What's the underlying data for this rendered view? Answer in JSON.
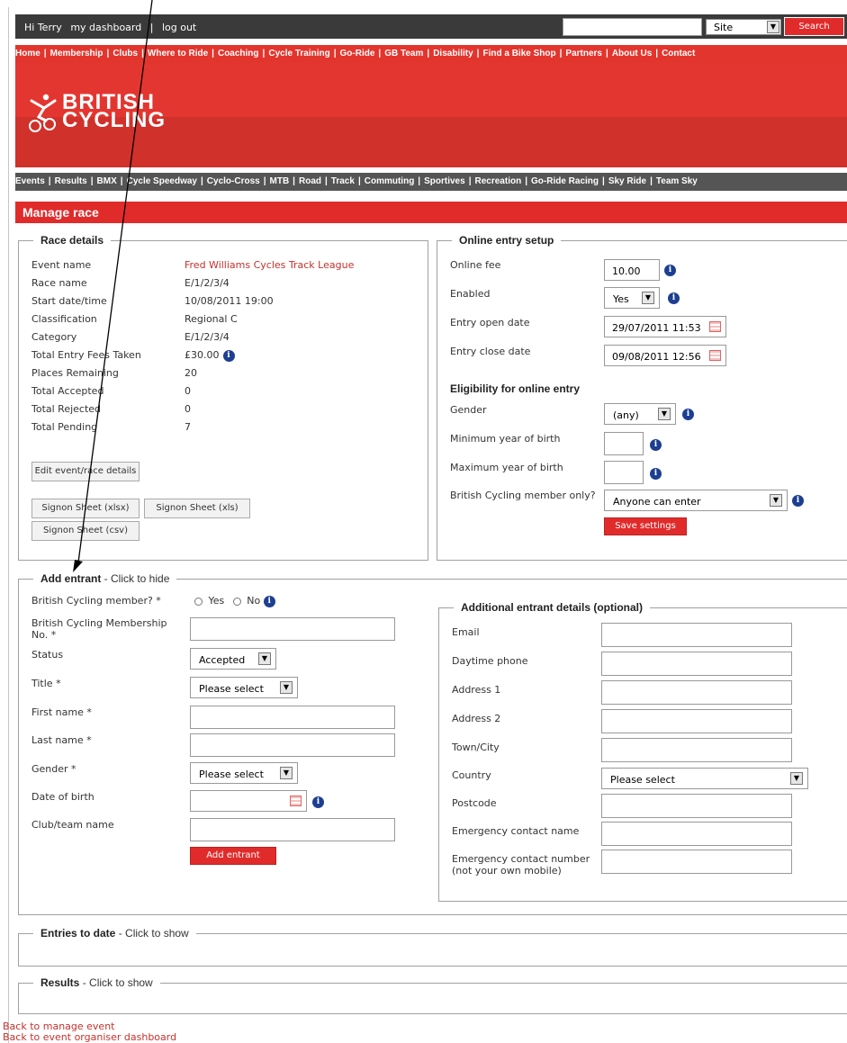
{
  "topbar": {
    "greeting": "Hi Terry",
    "dashboard": "my dashboard",
    "separator": "|",
    "logout": "log out",
    "site_select": "Site",
    "search_button": "Search"
  },
  "main_nav": [
    "Home",
    "Membership",
    "Clubs",
    "Where to Ride",
    "Coaching",
    "Cycle Training",
    "Go-Ride",
    "GB Team",
    "Disability",
    "Find a Bike Shop",
    "Partners",
    "About Us",
    "Contact"
  ],
  "brand": {
    "line1": "BRITISH",
    "line2": "CYCLING"
  },
  "sub_nav": [
    "Events",
    "Results",
    "BMX",
    "Cycle Speedway",
    "Cyclo-Cross",
    "MTB",
    "Road",
    "Track",
    "Commuting",
    "Sportives",
    "Recreation",
    "Go-Ride Racing",
    "Sky Ride",
    "Team Sky"
  ],
  "page_title": "Manage race",
  "race_details": {
    "legend": "Race details",
    "rows": [
      {
        "label": "Event name",
        "value": "Fred Williams Cycles Track League"
      },
      {
        "label": "Race name",
        "value": "E/1/2/3/4"
      },
      {
        "label": "Start date/time",
        "value": "10/08/2011 19:00"
      },
      {
        "label": "Classification",
        "value": "Regional C"
      },
      {
        "label": "Category",
        "value": "E/1/2/3/4"
      },
      {
        "label": "Total Entry Fees Taken",
        "value": "£30.00"
      },
      {
        "label": "Places Remaining",
        "value": "20"
      },
      {
        "label": "Total Accepted",
        "value": "0"
      },
      {
        "label": "Total Rejected",
        "value": "0"
      },
      {
        "label": "Total Pending",
        "value": "7"
      }
    ],
    "edit_button": "Edit event/race details",
    "signon_xlsx": "Signon Sheet (xlsx)",
    "signon_xls": "Signon Sheet (xls)",
    "signon_csv": "Signon Sheet (csv)"
  },
  "online_entry": {
    "legend": "Online entry setup",
    "fee_label": "Online fee",
    "fee_value": "10.00",
    "enabled_label": "Enabled",
    "enabled_value": "Yes",
    "open_label": "Entry open date",
    "open_value": "29/07/2011 11:53",
    "close_label": "Entry close date",
    "close_value": "09/08/2011 12:56",
    "eligibility_heading": "Eligibility for online entry",
    "gender_label": "Gender",
    "gender_value": "(any)",
    "min_yob_label": "Minimum year of birth",
    "max_yob_label": "Maximum year of birth",
    "member_only_label": "British Cycling member only?",
    "member_only_value": "Anyone can enter",
    "save_button": "Save settings"
  },
  "add_entrant": {
    "legend": "Add entrant",
    "toggle": " - Click to hide",
    "member_label": "British Cycling member? *",
    "yes": "Yes",
    "no": "No",
    "membership_no_label": "British Cycling Membership No. *",
    "status_label": "Status",
    "status_value": "Accepted",
    "title_label": "Title *",
    "title_value": "Please select",
    "first_name_label": "First name *",
    "last_name_label": "Last name *",
    "gender_label": "Gender *",
    "gender_value": "Please select",
    "dob_label": "Date of birth",
    "club_label": "Club/team name",
    "add_button": "Add entrant"
  },
  "additional": {
    "legend": "Additional entrant details (optional)",
    "email": "Email",
    "phone": "Daytime phone",
    "addr1": "Address 1",
    "addr2": "Address 2",
    "town": "Town/City",
    "country": "Country",
    "country_value": "Please select",
    "postcode": "Postcode",
    "ec_name": "Emergency contact name",
    "ec_number_1": "Emergency contact number",
    "ec_number_2": "(not your own mobile)"
  },
  "entries": {
    "legend": "Entries to date",
    "toggle": " - Click to show"
  },
  "results": {
    "legend": "Results",
    "toggle": " - Click to show"
  },
  "links": {
    "back_event": "Back to manage event",
    "back_dashboard": "Back to event organiser dashboard"
  },
  "info_glyph": "i",
  "colors": {
    "brand_red": "#e2352d",
    "dark_bar": "#3a3a3a",
    "sub_nav": "#555555",
    "info_blue": "#1d3f91",
    "link_red": "#c5312d"
  }
}
